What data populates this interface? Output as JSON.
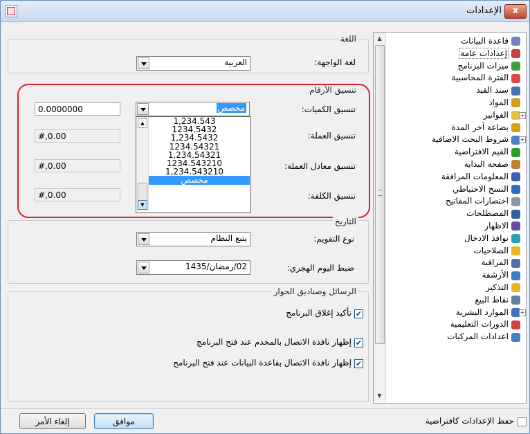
{
  "window": {
    "title": "الإعدادات",
    "close_label": "x"
  },
  "tree": {
    "items": [
      {
        "label": "قاعدة البيانات",
        "icon": "database-icon",
        "color": "#7080c0",
        "expander": false
      },
      {
        "label": "إعدادات عامة",
        "icon": "settings-checklist-icon",
        "color": "#d04040",
        "expander": false,
        "selected": true
      },
      {
        "label": "ميزات البرنامج",
        "icon": "puzzle-icon",
        "color": "#40a040",
        "expander": false
      },
      {
        "label": "الفترة المحاسبية",
        "icon": "calendar-icon",
        "color": "#e04848",
        "expander": false
      },
      {
        "label": "سند القيد",
        "icon": "document-icon",
        "color": "#4a6fb0",
        "expander": false
      },
      {
        "label": "المواد",
        "icon": "box-icon",
        "color": "#d4a017",
        "expander": false
      },
      {
        "label": "الفواتير",
        "icon": "folder-icon",
        "color": "#e8c040",
        "expander": true
      },
      {
        "label": "بضاعة آخر المدة",
        "icon": "goods-icon",
        "color": "#d4a017",
        "expander": false
      },
      {
        "label": "شروط البحث الاضافية",
        "icon": "search-icon",
        "color": "#5080c0",
        "expander": true
      },
      {
        "label": "القيم الافتراضية",
        "icon": "checkmark-icon",
        "color": "#2aa02a",
        "expander": false
      },
      {
        "label": "صفحة البداية",
        "icon": "home-check-icon",
        "color": "#c08030",
        "expander": false
      },
      {
        "label": "المعلومات المرافقة",
        "icon": "info-icon",
        "color": "#4060b0",
        "expander": false
      },
      {
        "label": "النسخ الاحتياطي",
        "icon": "backup-icon",
        "color": "#3070c0",
        "expander": false
      },
      {
        "label": "اختصارات المفاتيح",
        "icon": "key-icon",
        "color": "#8898a8",
        "expander": false
      },
      {
        "label": "المصطلحات",
        "icon": "glossary-icon",
        "color": "#3060a0",
        "expander": false
      },
      {
        "label": "الاظهار",
        "icon": "display-icon",
        "color": "#6a4aa8",
        "expander": false
      },
      {
        "label": "نوافذ الادخال",
        "icon": "edit-window-icon",
        "color": "#2aa0b0",
        "expander": false
      },
      {
        "label": "الصلاحيات",
        "icon": "lock-icon",
        "color": "#e8b820",
        "expander": false
      },
      {
        "label": "المراقبة",
        "icon": "monitor-icon",
        "color": "#5070b0",
        "expander": false
      },
      {
        "label": "الأرشفة",
        "icon": "archive-icon",
        "color": "#4080c0",
        "expander": false
      },
      {
        "label": "التذكير",
        "icon": "bell-icon",
        "color": "#e8b820",
        "expander": false
      },
      {
        "label": "نقاط البيع",
        "icon": "pos-icon",
        "color": "#6080a0",
        "expander": false
      },
      {
        "label": "الموارد البشرية",
        "icon": "people-icon",
        "color": "#4070c0",
        "expander": true
      },
      {
        "label": "الدورات التعليمية",
        "icon": "course-icon",
        "color": "#d04040",
        "expander": false
      },
      {
        "label": "اعدادات المركبات",
        "icon": "vehicle-icon",
        "color": "#4080c0",
        "expander": false
      }
    ]
  },
  "language": {
    "group_title": "اللغة",
    "ui_language_label": "لغة الواجهة:",
    "ui_language_value": "العربية"
  },
  "numbers": {
    "group_title": "تنسيق الأرقام",
    "quantity_label": "تنسيق الكميات:",
    "quantity_combo_value": "مخصص",
    "quantity_text": "0.0000000",
    "currency_label": "تنسيق العملة:",
    "currency_text": "#,0.00",
    "exchange_label": "تنسيق معادل العملة:",
    "exchange_text": "#,0.00",
    "cost_label": "تنسيق الكلفة:",
    "cost_text": "#,0.00",
    "dropdown_options": [
      "1,234.543",
      "1234.5432",
      "1,234.5432",
      "1234.54321",
      "1,234.54321",
      "1234.543210",
      "1,234.543210",
      "مخصص"
    ]
  },
  "date": {
    "group_title": "التاريخ",
    "calendar_label": "نوع التقويم:",
    "calendar_value": "يتبع النظام",
    "hijri_label": "ضبط اليوم الهجري:",
    "hijri_value": "02/رمضان/1435"
  },
  "messages": {
    "group_title": "الرسائل وصناديق الحوار",
    "confirm_close": "تأكيد إغلاق البرنامج",
    "show_server_connection": "إظهار نافذة الاتصال بالمخدم عند فتح البرنامج",
    "show_db_connection": "إظهار نافذة الاتصال بقاعدة البيانات عند فتح البرنامج"
  },
  "footer": {
    "save_default": "حفظ الإعدادات كافتراضية",
    "ok": "موافق",
    "cancel": "إلغاء الأمر"
  }
}
